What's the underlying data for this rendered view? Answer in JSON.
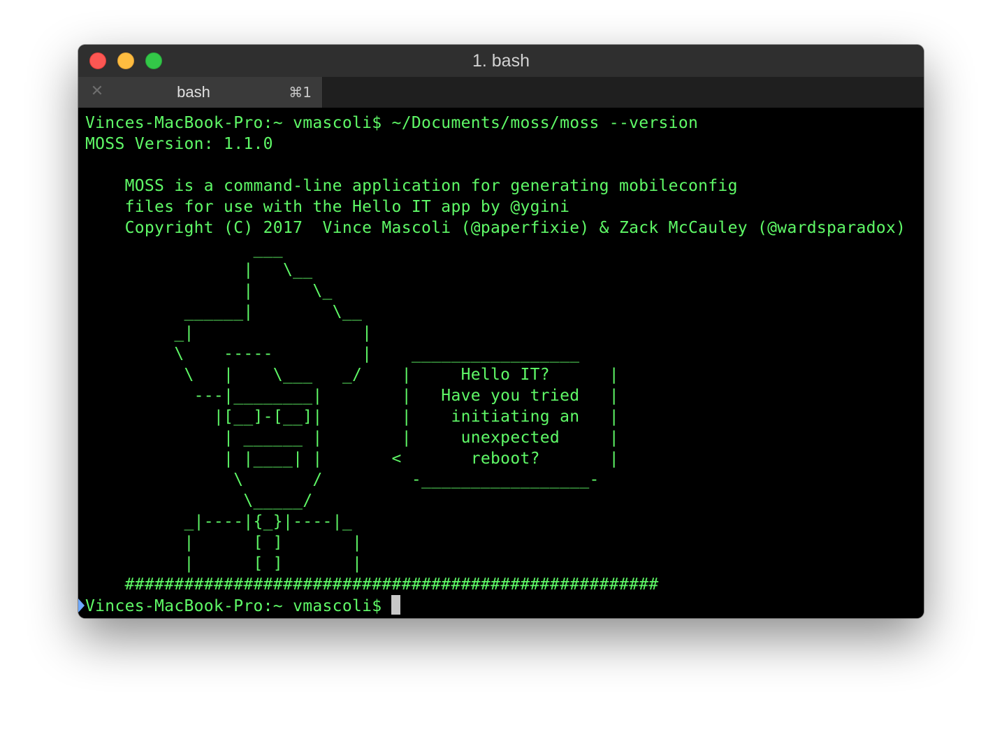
{
  "window": {
    "title": "1. bash",
    "colors": {
      "close": "#fc5753",
      "minimize": "#fdbc40",
      "zoom": "#33c748",
      "text": "#5ff967",
      "background": "#000000"
    }
  },
  "tabs": [
    {
      "label": "bash",
      "shortcut": "⌘1",
      "close_icon": "close-icon"
    }
  ],
  "terminal": {
    "output": "Vinces-MacBook-Pro:~ vmascoli$ ~/Documents/moss/moss --version\nMOSS Version: 1.1.0\n\n    MOSS is a command-line application for generating mobileconfig\n    files for use with the Hello IT app by @ygini\n    Copyright (C) 2017  Vince Mascoli (@paperfixie) & Zack McCauley (@wardsparadox)\n                 ___\n                |   \\__\n                |      \\_\n          ______|        \\__\n         _|                 |\n         \\    -----         |    _________________\n          \\   |    \\___   _/    |     Hello IT?      |\n           ---|________|        |   Have you tried   |\n             |[__]-[__]|        |    initiating an   |\n              | ______ |        |     unexpected     |\n              | |____| |       <       reboot?       |\n               \\       /         -_________________-\n                \\_____/\n          _|----|{_}|----|_\n          |      [ ]       |\n          |      [ ]       |\n    ######################################################",
    "prompt": "Vinces-MacBook-Pro:~ vmascoli$"
  }
}
